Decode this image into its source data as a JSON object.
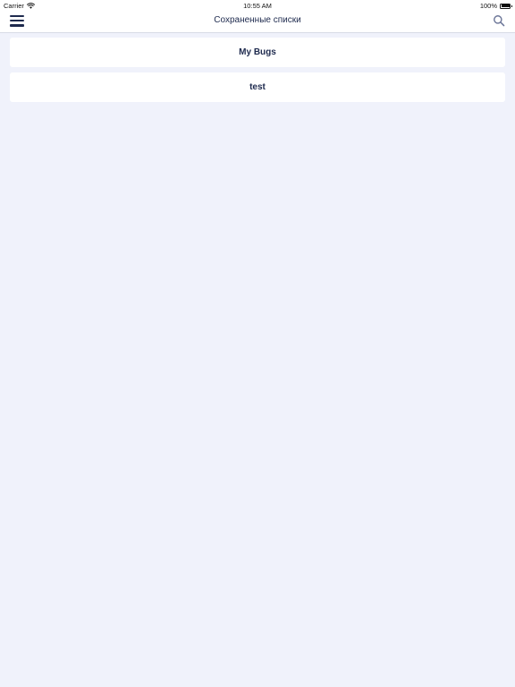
{
  "status_bar": {
    "carrier": "Carrier",
    "time": "10:55 AM",
    "battery": "100%",
    "battery_level": 1.0
  },
  "nav": {
    "title": "Сохраненные списки",
    "menu_icon": "hamburger-menu-icon",
    "search_icon": "search-icon"
  },
  "lists": [
    {
      "label": "My Bugs"
    },
    {
      "label": "test"
    }
  ],
  "colors": {
    "background": "#f0f2fb",
    "card": "#ffffff",
    "text": "#1e2a4e",
    "icon_muted": "#6b7597"
  }
}
